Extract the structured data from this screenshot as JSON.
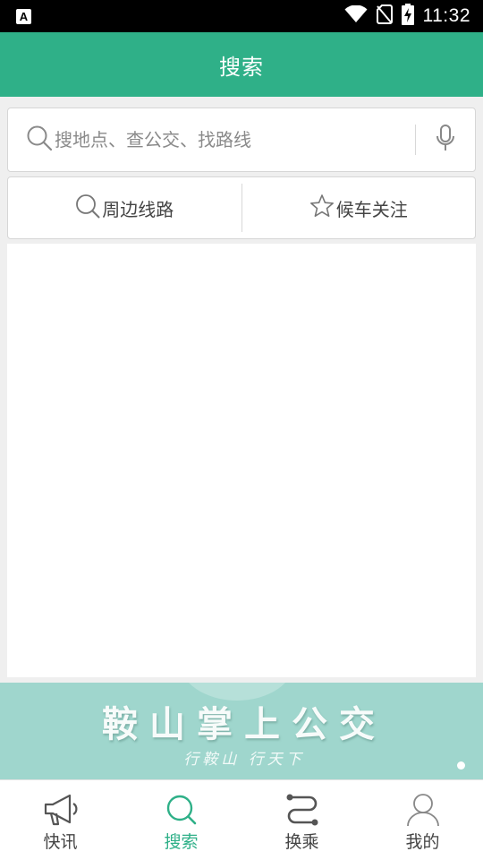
{
  "status_bar": {
    "left_icon": "A",
    "time": "11:32",
    "icons": [
      "wifi-icon",
      "no-sim-icon",
      "battery-charging-icon"
    ]
  },
  "header": {
    "title": "搜索"
  },
  "search": {
    "placeholder": "搜地点、查公交、找路线",
    "value": ""
  },
  "actions": [
    {
      "label": "周边线路",
      "icon": "search-icon"
    },
    {
      "label": "候车关注",
      "icon": "star-icon"
    }
  ],
  "banner": {
    "title": "鞍山掌上公交",
    "slogan": "行鞍山 行天下"
  },
  "bottom_nav": [
    {
      "label": "快讯",
      "icon": "megaphone-icon",
      "active": false
    },
    {
      "label": "搜索",
      "icon": "search-icon",
      "active": true
    },
    {
      "label": "换乘",
      "icon": "route-icon",
      "active": false
    },
    {
      "label": "我的",
      "icon": "person-icon",
      "active": false
    }
  ],
  "colors": {
    "brand": "#2fb088",
    "banner": "#9fd6cd",
    "background": "#efefef"
  }
}
